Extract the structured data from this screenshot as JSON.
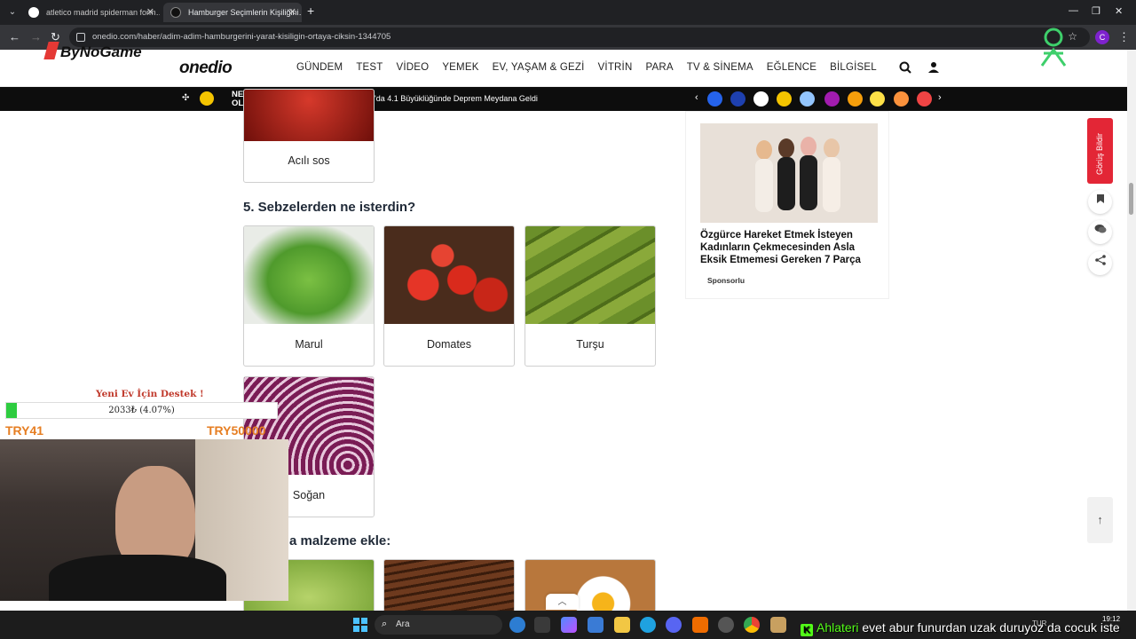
{
  "browser": {
    "tabs": [
      {
        "title": "atletico madrid spiderman form…",
        "active": false
      },
      {
        "title": "Hamburger Seçimlerin Kişiliğini…",
        "active": true
      }
    ],
    "url": "onedio.com/haber/adim-adim-hamburgerini-yarat-kisiligin-ortaya-ciksin-1344705",
    "profile_initial": "C"
  },
  "site": {
    "logo": "onedio",
    "nav": [
      "GÜNDEM",
      "TEST",
      "VİDEO",
      "YEMEK",
      "EV, YAŞAM & GEZİ",
      "VİTRİN",
      "PARA",
      "TV & SİNEMA",
      "EĞLENCE",
      "BİLGİSEL"
    ],
    "ticker_label_line1": "NELER",
    "ticker_label_line2": "OLUYOR?",
    "ticker_news": "AFAD Duyurdu: Ankara'da 4.1 Büyüklüğünde Deprem Meydana Geldi"
  },
  "quiz": {
    "prev_option": "Acılı sos",
    "question5": "5. Sebzelerden ne isterdin?",
    "options": [
      "Marul",
      "Domates",
      "Turşu",
      "Soğan"
    ],
    "question6_partial": "a malzeme ekle:"
  },
  "ad": {
    "title": "Özgürce Hareket Etmek İsteyen Kadınların Çekmecesinden Asla Eksik Etmemesi Gereken 7 Parça",
    "sponsor": "Sponsorlu"
  },
  "sidebar": {
    "feedback": "Görüş Bildir"
  },
  "stream": {
    "brand": "ByNoGame",
    "donation_title": "Yeni Ev İçin Destek !",
    "donation_progress": "2033₺ (4.07%)",
    "donation_percent": 4.07,
    "donation_min": "TRY41",
    "donation_max": "TRY50000",
    "chat_user": "Ahlateri",
    "chat_message": "evet abur funurdan uzak duruyoz da cocuk iste"
  },
  "taskbar": {
    "search_placeholder": "Ara",
    "clock_time": "19:12",
    "lang": "TUR"
  },
  "colors": {
    "feedback_red": "#e32636",
    "ticker_bg": "#0d0d0d",
    "donation_green": "#2ecc40",
    "kick_green": "#53fc18"
  }
}
